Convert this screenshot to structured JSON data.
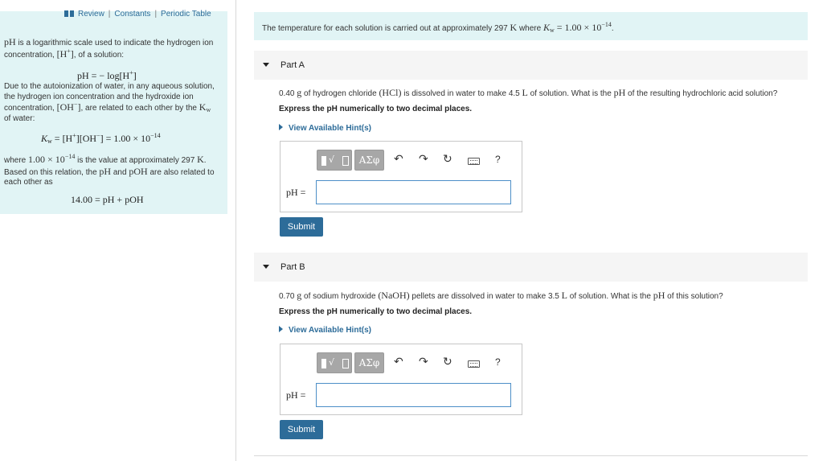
{
  "sidebar": {
    "links": [
      "Review",
      "Constants",
      "Periodic Table"
    ],
    "intro_1": "is a logarithmic scale used to indicate the hydrogen ion concentration,",
    "intro_2": ", of a solution:",
    "ph_word": "pH",
    "ion_h": "[H",
    "ion_h_sup": "+",
    "ion_h_close": "]",
    "eq1": "pH = − log[H",
    "eq1_sup": "+",
    "eq1_close": "]",
    "para2_1": "Due to the autoionization of water, in any aqueous solution, the hydrogen ion concentration and the hydroxide ion concentration,",
    "para2_oh": "[OH",
    "para2_oh_sup": "−",
    "para2_oh_close": "]",
    "para2_2": ", are related to each other by the",
    "para2_kw": "K",
    "para2_kw_sub": "w",
    "para2_3": "of water:",
    "eq2_k": "K",
    "eq2_k_sub": "w",
    "eq2_rest1": " = [H",
    "eq2_sup1": "+",
    "eq2_rest2": "][OH",
    "eq2_sup2": "−",
    "eq2_rest3": "] = 1.00 × 10",
    "eq2_exp": "−14",
    "para3_1": "where",
    "para3_val": "1.00 × 10",
    "para3_exp": "−14",
    "para3_2": "is the value at approximately 297",
    "para3_k": "K",
    "para3_3": ". Based on this relation, the",
    "para3_ph": "pH",
    "para3_4": "and",
    "para3_poh": "pOH",
    "para3_5": "are also related to each other as",
    "eq3": "14.00 = pH + pOH"
  },
  "notice": {
    "text": "The temperature for each solution is carried out at approximately 297",
    "k": "K",
    "where": "where",
    "kw": "K",
    "kw_sub": "w",
    "eq": "= 1.00 × 10",
    "exp": "−14",
    "end": "."
  },
  "parts": [
    {
      "title": "Part A",
      "q1": "0.40",
      "q2": "g",
      "q3": "of hydrogen chloride",
      "q4": "(HCl)",
      "q5": "is dissolved in water to make 4.5",
      "q6": "L",
      "q7": "of solution. What is the",
      "q8": "pH",
      "q9": "of the resulting hydrochloric acid solution?",
      "express": "Express the pH numerically to two decimal places.",
      "hint": "View Available Hint(s)",
      "answer_label": "pH =",
      "answer_value": "",
      "submit": "Submit"
    },
    {
      "title": "Part B",
      "q1": "0.70",
      "q2": "g",
      "q3": "of sodium hydroxide",
      "q4": "(NaOH)",
      "q5": "pellets are dissolved in water to make 3.5",
      "q6": "L",
      "q7": "of solution. What is the",
      "q8": "pH",
      "q9": "of this solution?",
      "express": "Express the pH numerically to two decimal places.",
      "hint": "View Available Hint(s)",
      "answer_label": "pH =",
      "answer_value": "",
      "submit": "Submit"
    }
  ],
  "toolbar": {
    "greek_label": "ΑΣφ",
    "radical_label": "√",
    "help_label": "?",
    "undo_glyph": "↶",
    "redo_glyph": "↷",
    "reset_glyph": "↻"
  },
  "colors": {
    "accent": "#2d6c99",
    "panel": "#e1f4f5",
    "header": "#f5f5f5"
  }
}
